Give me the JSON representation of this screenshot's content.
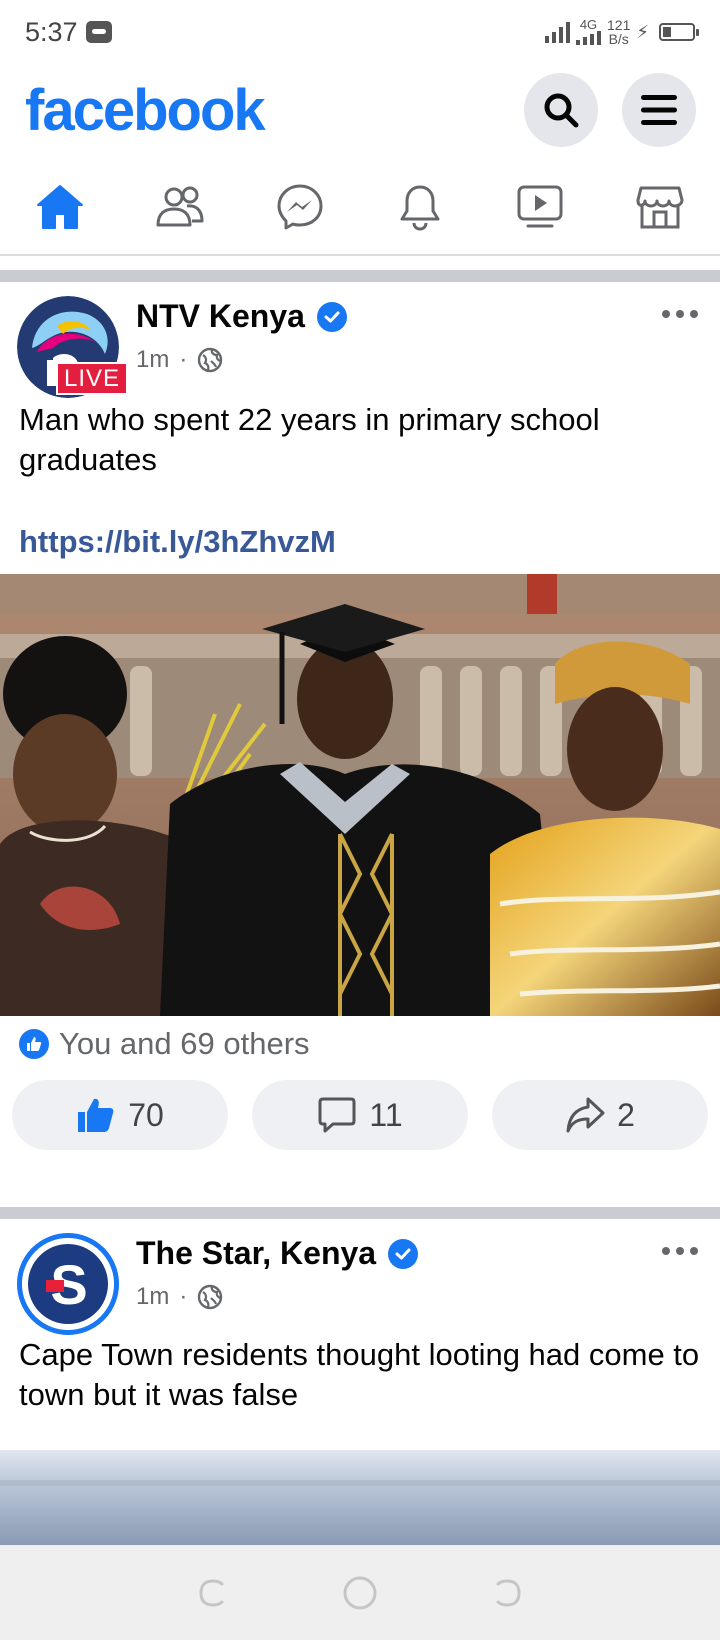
{
  "status": {
    "time": "5:37",
    "network": "4G",
    "speed_value": "121",
    "speed_unit": "B/s"
  },
  "header": {
    "logo": "facebook"
  },
  "nav": {
    "tabs": [
      "home",
      "friends",
      "messenger",
      "notifications",
      "watch",
      "marketplace"
    ],
    "active": "home"
  },
  "colors": {
    "brand": "#1877f2",
    "link": "#385898",
    "live": "#e41e3f"
  },
  "posts": [
    {
      "page": "NTV Kenya",
      "live_badge": "LIVE",
      "time": "1m",
      "text": "Man who spent 22 years in primary school graduates",
      "link": "https://bit.ly/3hZhvzM",
      "reaction_summary": "You and 69 others",
      "likes": "70",
      "comments": "11",
      "shares": "2"
    },
    {
      "page": "The Star, Kenya",
      "time": "1m",
      "text": "Cape Town residents thought looting had come to town but it was false"
    }
  ]
}
